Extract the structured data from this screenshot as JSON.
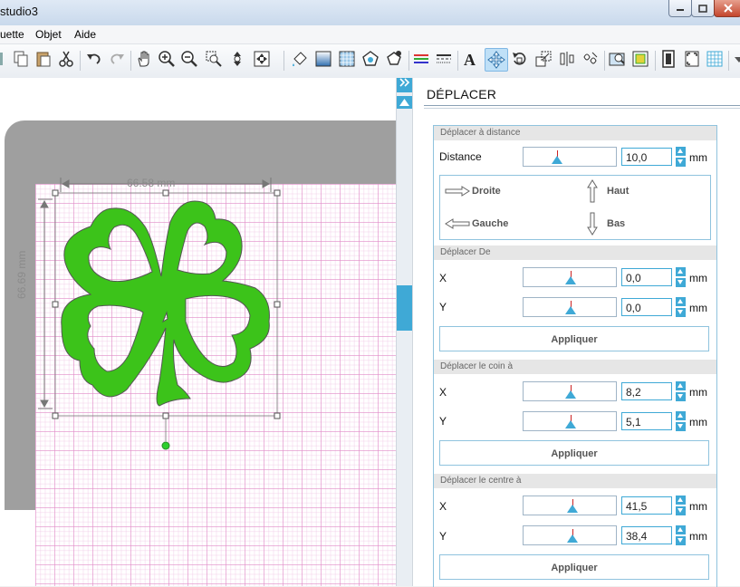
{
  "window": {
    "title": "studio3"
  },
  "menu": {
    "items": [
      "uette",
      "Objet",
      "Aide"
    ]
  },
  "toolbar": {
    "icons": [
      "copy-icon",
      "paste-icon",
      "cut-icon",
      "undo-icon",
      "redo-icon",
      "pan-hand-icon",
      "zoom-in-icon",
      "zoom-out-icon",
      "zoom-box-icon",
      "zoom-drag-icon",
      "zoom-fit-icon",
      "fill-icon",
      "gradient-icon",
      "pattern-icon",
      "shape-stroke-icon",
      "shape-fill-icon",
      "line-color-icon",
      "line-style-icon",
      "text-icon",
      "move-icon",
      "rotate-icon",
      "scale-icon",
      "align-icon",
      "replicate-icon",
      "trace-icon",
      "offset-icon",
      "page-setup-icon",
      "registration-icon",
      "grid-icon"
    ]
  },
  "canvas": {
    "width_dimension": "66.58 mm",
    "height_dimension": "66.69 mm",
    "shape_color": "#3cc31a"
  },
  "panel": {
    "title": "DÉPLACER",
    "sections": {
      "distance": {
        "header": "Déplacer à distance",
        "label": "Distance",
        "value": "10,0",
        "unit": "mm",
        "directions": {
          "right": "Droite",
          "up": "Haut",
          "left": "Gauche",
          "down": "Bas"
        }
      },
      "move_by": {
        "header": "Déplacer De",
        "x_label": "X",
        "x_value": "0,0",
        "y_label": "Y",
        "y_value": "0,0",
        "unit": "mm",
        "apply": "Appliquer"
      },
      "corner": {
        "header": "Déplacer le coin à",
        "x_label": "X",
        "x_value": "8,2",
        "y_label": "Y",
        "y_value": "5,1",
        "unit": "mm",
        "apply": "Appliquer"
      },
      "center": {
        "header": "Déplacer le centre à",
        "x_label": "X",
        "x_value": "41,5",
        "y_label": "Y",
        "y_value": "38,4",
        "unit": "mm",
        "apply": "Appliquer"
      }
    }
  },
  "colors": {
    "accent": "#3fa9d6",
    "mat": "#9f9f9f",
    "grid": "#e8a0d6"
  }
}
